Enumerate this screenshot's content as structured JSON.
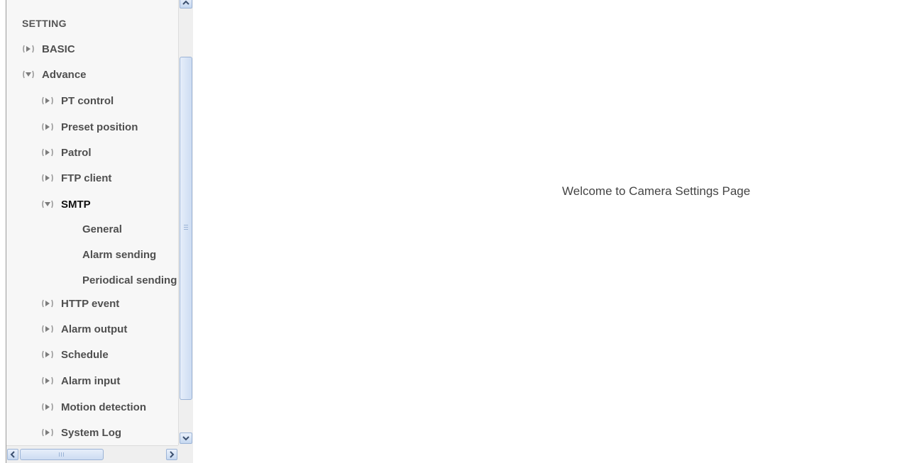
{
  "nav": {
    "heading": "SETTING",
    "items": [
      {
        "label": "BASIC",
        "expanded": false
      },
      {
        "label": "Advance",
        "expanded": true
      }
    ],
    "advance_items": [
      {
        "label": "PT control",
        "expanded": false
      },
      {
        "label": "Preset position",
        "expanded": false
      },
      {
        "label": "Patrol",
        "expanded": false
      },
      {
        "label": "FTP client",
        "expanded": false
      },
      {
        "label": "SMTP",
        "expanded": true,
        "active": true
      },
      {
        "label": "HTTP event",
        "expanded": false
      },
      {
        "label": "Alarm output",
        "expanded": false
      },
      {
        "label": "Schedule",
        "expanded": false
      },
      {
        "label": "Alarm input",
        "expanded": false
      },
      {
        "label": "Motion detection",
        "expanded": false
      },
      {
        "label": "System Log",
        "expanded": false
      }
    ],
    "smtp_subitems": [
      "General",
      "Alarm sending",
      "Periodical sending"
    ]
  },
  "main": {
    "welcome_text": "Welcome to Camera Settings Page"
  },
  "icons": {
    "collapsed": "arrow-right-bullet-icon",
    "expanded": "arrow-down-bullet-icon"
  },
  "colors": {
    "text": "#4f4f4f",
    "active": "#111111",
    "scrollbar": "#c5d7f0"
  }
}
